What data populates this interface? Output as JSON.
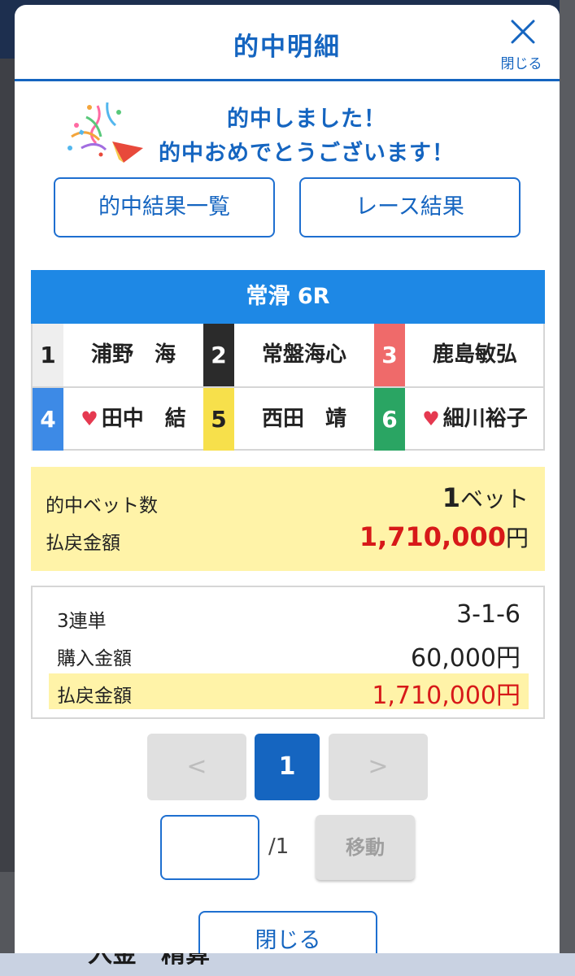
{
  "modal": {
    "title": "的中明細",
    "close_label": "閉じる"
  },
  "congrats": {
    "line1": "的中しました！",
    "line2": "的中おめでとうございます！"
  },
  "buttons": {
    "results_list": "的中結果一覧",
    "race_results": "レース結果"
  },
  "race": {
    "header": "常滑 6R",
    "racers": [
      {
        "num": "1",
        "name": "浦野　海",
        "heart": false,
        "color": "#eeeeee",
        "text_color": "#222222"
      },
      {
        "num": "2",
        "name": "常盤海心",
        "heart": false,
        "color": "#2b2b2b",
        "text_color": "#ffffff"
      },
      {
        "num": "3",
        "name": "鹿島敏弘",
        "heart": false,
        "color": "#ef6a6a",
        "text_color": "#ffffff"
      },
      {
        "num": "4",
        "name": "田中　結",
        "heart": true,
        "color": "#3d8ae6",
        "text_color": "#ffffff"
      },
      {
        "num": "5",
        "name": "西田　靖",
        "heart": false,
        "color": "#f7e04b",
        "text_color": "#222222"
      },
      {
        "num": "6",
        "name": "細川裕子",
        "heart": true,
        "color": "#2aa563",
        "text_color": "#ffffff"
      }
    ]
  },
  "summary": {
    "bet_count_label": "的中ベット数",
    "bet_count_value": "1",
    "bet_count_unit": "ベット",
    "payout_label": "払戻金額",
    "payout_value": "1,710,000",
    "payout_unit": "円"
  },
  "detail": {
    "bet_type_label": "3連単",
    "bet_type_value": "3-1-6",
    "purchase_label": "購入金額",
    "purchase_value": "60,000円",
    "payout_label": "払戻金額",
    "payout_value": "1,710,000円"
  },
  "pagination": {
    "prev": "<",
    "current": "1",
    "next": ">",
    "total": "/1",
    "move_label": "移動"
  },
  "footer": {
    "close_label": "閉じる"
  },
  "background": {
    "bottom_text": "入金　精算"
  },
  "colors": {
    "accent": "#1565c0",
    "race_header": "#1e88e5",
    "highlight": "#fff3a8",
    "payout_red": "#d71919"
  }
}
